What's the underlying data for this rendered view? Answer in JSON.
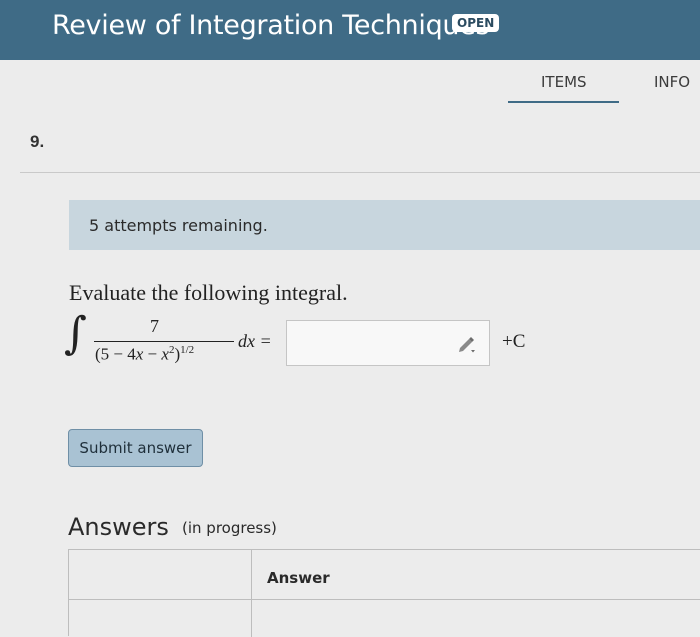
{
  "header": {
    "title": "Review of Integration Techniques",
    "status_badge": "OPEN"
  },
  "tabs": [
    {
      "label": "ITEMS",
      "active": true
    },
    {
      "label": "INFO",
      "active": false
    }
  ],
  "question": {
    "number": "9.",
    "attempts_text": "5 attempts remaining.",
    "prompt": "Evaluate the following integral.",
    "integral": {
      "sign": "∫",
      "numerator": "7",
      "den_open": "(5 − 4",
      "den_x1": "x",
      "den_minus": " − ",
      "den_x2": "x",
      "den_sq": "2",
      "den_close": ")",
      "den_exp": "1/2",
      "differential": "dx =",
      "constant": "+C"
    },
    "answer_value": ""
  },
  "submit_label": "Submit answer",
  "answers": {
    "heading": "Answers",
    "subheading": "(in progress)",
    "column_header": "Answer"
  },
  "colors": {
    "header_bg": "#3f6b86",
    "attempts_bg": "#c8d6de",
    "submit_bg": "#a9c2d3"
  }
}
